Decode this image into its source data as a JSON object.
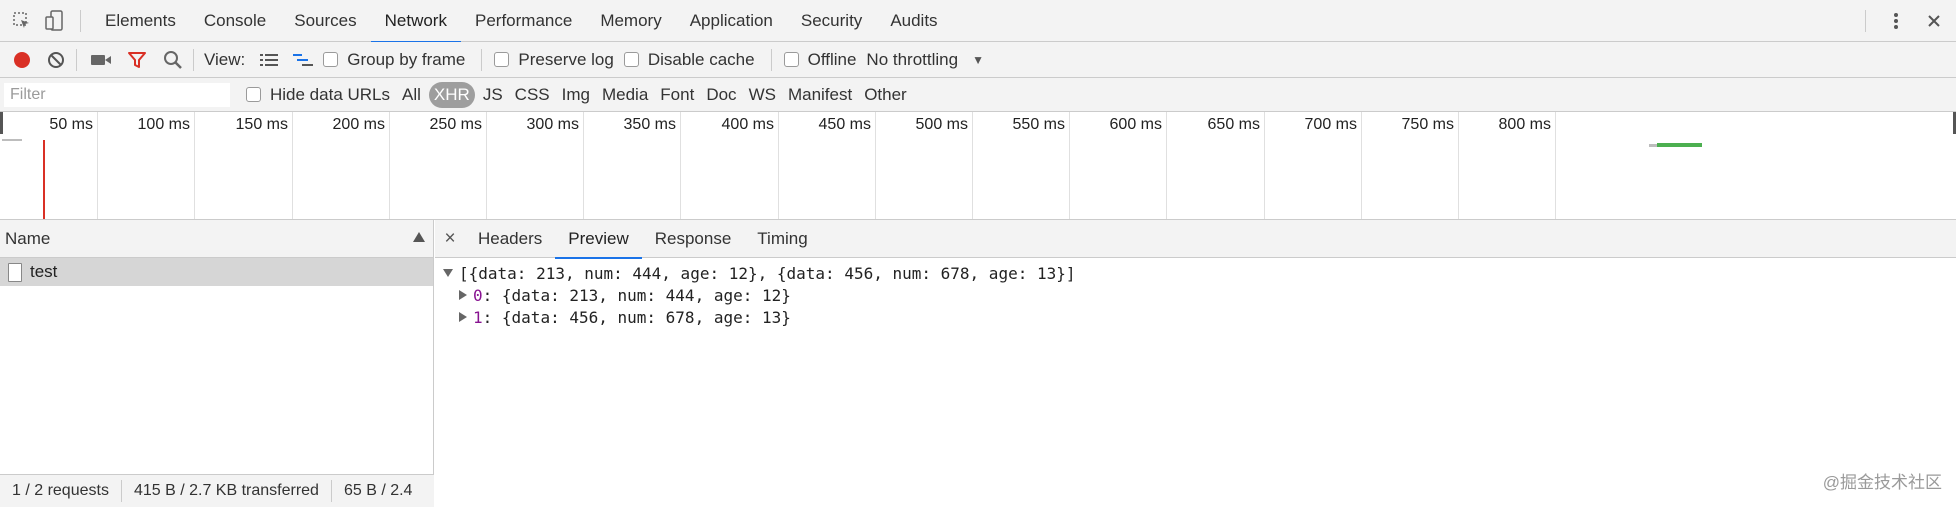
{
  "tabs": [
    {
      "label": "Elements"
    },
    {
      "label": "Console"
    },
    {
      "label": "Sources"
    },
    {
      "label": "Network"
    },
    {
      "label": "Performance"
    },
    {
      "label": "Memory"
    },
    {
      "label": "Application"
    },
    {
      "label": "Security"
    },
    {
      "label": "Audits"
    }
  ],
  "active_tab": "Network",
  "toolbar": {
    "view_label": "View:",
    "group_by_frame": "Group by frame",
    "preserve_log": "Preserve log",
    "disable_cache": "Disable cache",
    "offline": "Offline",
    "throttling": "No throttling"
  },
  "filter": {
    "placeholder": "Filter",
    "hide_data_urls": "Hide data URLs",
    "types": [
      "All",
      "XHR",
      "JS",
      "CSS",
      "Img",
      "Media",
      "Font",
      "Doc",
      "WS",
      "Manifest",
      "Other"
    ],
    "selected_type": "XHR"
  },
  "timeline": {
    "ticks": [
      "50 ms",
      "100 ms",
      "150 ms",
      "200 ms",
      "250 ms",
      "300 ms",
      "350 ms",
      "400 ms",
      "450 ms",
      "500 ms",
      "550 ms",
      "600 ms",
      "650 ms",
      "700 ms",
      "750 ms",
      "800 ms"
    ]
  },
  "requests": {
    "column_header": "Name",
    "rows": [
      {
        "name": "test"
      }
    ]
  },
  "status": {
    "requests": "1 / 2 requests",
    "transferred": "415 B / 2.7 KB transferred",
    "resources": "65 B / 2.4"
  },
  "detail": {
    "close": "×",
    "tabs": [
      "Headers",
      "Preview",
      "Response",
      "Timing"
    ],
    "active_tab": "Preview",
    "preview": {
      "summary": "[{data: 213, num: 444, age: 12}, {data: 456, num: 678, age: 13}]",
      "items": [
        {
          "key": "0",
          "value": ": {data: 213, num: 444, age: 12}"
        },
        {
          "key": "1",
          "value": ": {data: 456, num: 678, age: 13}"
        }
      ]
    }
  },
  "watermark": "@掘金技术社区",
  "colors": {
    "record": "#d93025",
    "filter_icon": "#d93025",
    "accent": "#1a73e8",
    "dom_content_loaded_line": "#d93025",
    "waterfall_bar": "#4caf50"
  }
}
